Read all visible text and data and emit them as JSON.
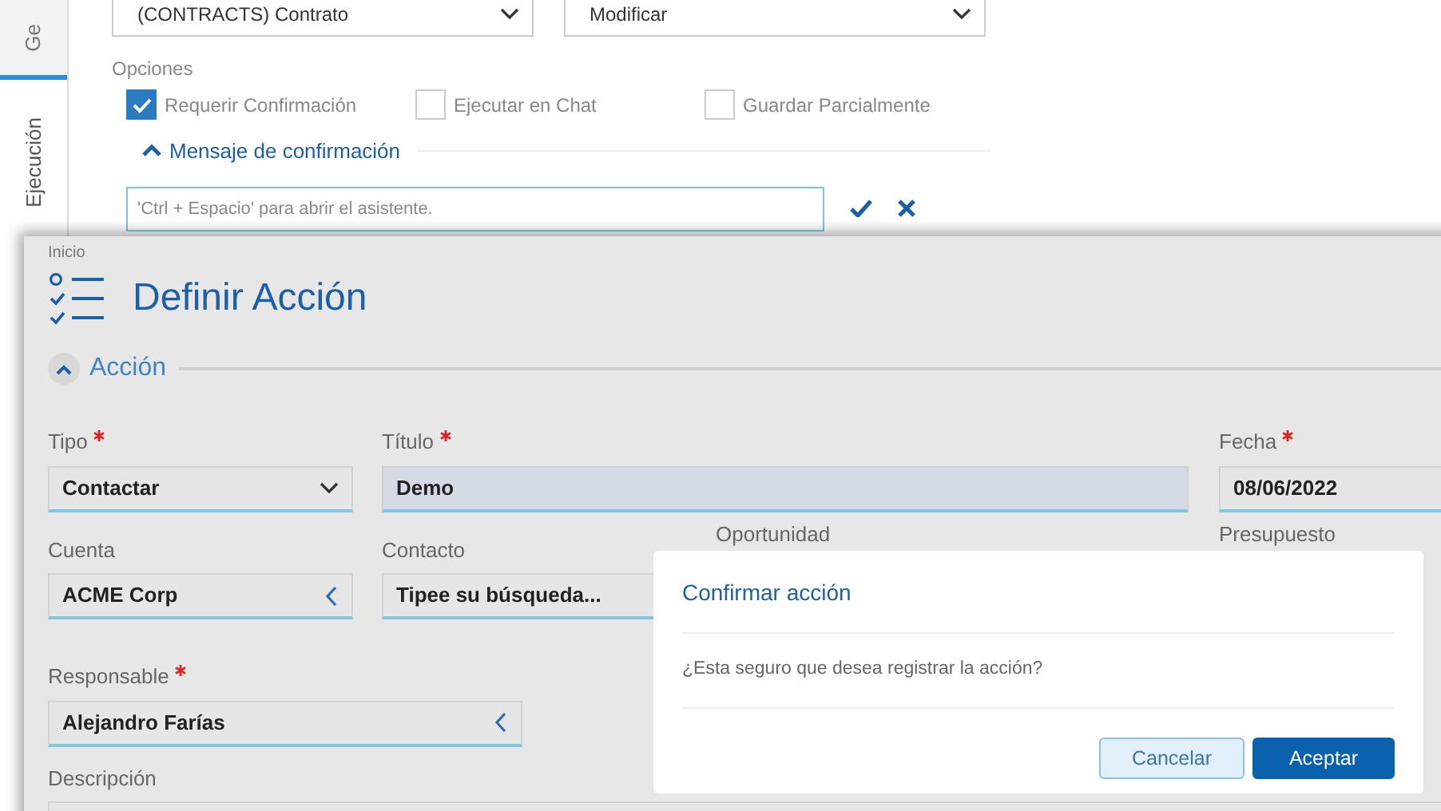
{
  "background_panel": {
    "tabs": [
      {
        "label": "Ge",
        "selected": true
      },
      {
        "label": "Ejecución",
        "selected": false
      }
    ],
    "selects": [
      {
        "value": "(CONTRACTS) Contrato"
      },
      {
        "value": "Modificar"
      }
    ],
    "options_label": "Opciones",
    "options": [
      {
        "label": "Requerir Confirmación",
        "checked": true
      },
      {
        "label": "Ejecutar en Chat",
        "checked": false
      },
      {
        "label": "Guardar Parcialmente",
        "checked": false
      }
    ],
    "confirmation_section": {
      "title": "Mensaje de confirmación",
      "expanded": true,
      "placeholder": "'Ctrl + Espacio' para abrir el asistente."
    }
  },
  "form_window": {
    "breadcrumb": "Inicio",
    "title": "Definir Acción",
    "section": {
      "title": "Acción",
      "expanded": true
    },
    "rows": [
      [
        {
          "label": "Tipo",
          "required": true,
          "kind": "select",
          "value": "Contactar"
        },
        {
          "label": "Título",
          "required": true,
          "kind": "text",
          "value": "Demo"
        },
        "",
        {
          "label": "Fecha",
          "required": true,
          "kind": "date",
          "value": "08/06/2022"
        }
      ],
      [
        {
          "label": "Cuenta",
          "required": false,
          "kind": "lookup",
          "value": "ACME Corp"
        },
        {
          "label": "Contacto",
          "required": false,
          "kind": "search",
          "value": "Tipee su búsqueda..."
        },
        {
          "label": "Oportunidad",
          "required": false,
          "kind": "hidden"
        },
        {
          "label": "Presupuesto",
          "required": false,
          "kind": "hidden"
        }
      ],
      [
        {
          "label": "Responsable",
          "required": true,
          "kind": "lookup",
          "value": "Alejandro Farías"
        }
      ],
      [
        {
          "label": "Descripción",
          "required": false,
          "kind": "textarea"
        }
      ]
    ]
  },
  "dialog": {
    "title": "Confirmar acción",
    "message": "¿Esta seguro que desea registrar la acción?",
    "buttons": [
      {
        "label": "Cancelar",
        "kind": "secondary"
      },
      {
        "label": "Aceptar",
        "kind": "primary"
      }
    ]
  }
}
